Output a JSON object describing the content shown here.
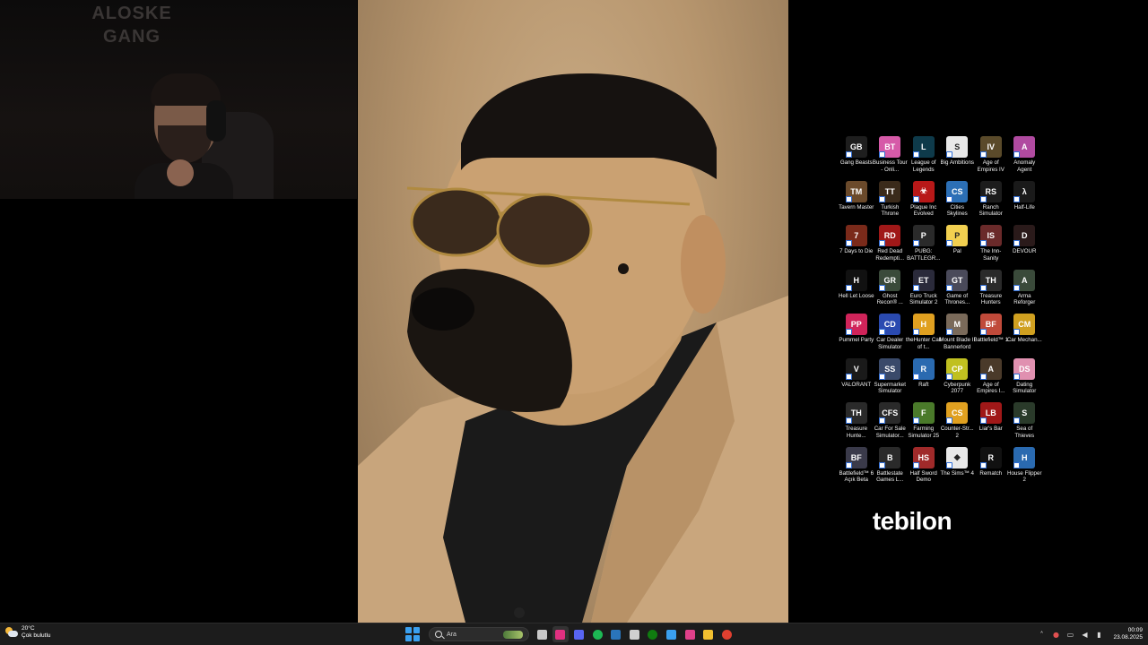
{
  "webcam": {
    "overlay_lines": [
      "ALOSKE",
      "GANG"
    ]
  },
  "desktop": {
    "icons": [
      {
        "label": "Gang Beasts",
        "color": "#1e1e1e",
        "glyph": "GB",
        "icon": "game-icon"
      },
      {
        "label": "Business Tour - Onli...",
        "color": "#d65aa8",
        "glyph": "BT",
        "icon": "game-icon"
      },
      {
        "label": "League of Legends",
        "color": "#0e3a4a",
        "glyph": "L",
        "icon": "game-icon"
      },
      {
        "label": "Big Ambitions",
        "color": "#e8e8e8",
        "glyph": "S",
        "icon": "game-icon"
      },
      {
        "label": "Age of Empires IV",
        "color": "#5a4a2a",
        "glyph": "IV",
        "icon": "game-icon"
      },
      {
        "label": "Anomaly Agent",
        "color": "#b04aa0",
        "glyph": "A",
        "icon": "game-icon"
      },
      {
        "label": "Tavern Master",
        "color": "#6b4a2b",
        "glyph": "TM",
        "icon": "game-icon"
      },
      {
        "label": "Turkish Throne",
        "color": "#3a2a1a",
        "glyph": "TT",
        "icon": "game-icon"
      },
      {
        "label": "Plague Inc Evolved",
        "color": "#b81818",
        "glyph": "☣",
        "icon": "game-icon"
      },
      {
        "label": "Cities Skylines",
        "color": "#2c6fb5",
        "glyph": "CS",
        "icon": "game-icon"
      },
      {
        "label": "Ranch Simulator",
        "color": "#1c1c1c",
        "glyph": "RS",
        "icon": "game-icon"
      },
      {
        "label": "Half-Life",
        "color": "#1a1a1a",
        "glyph": "λ",
        "icon": "game-icon"
      },
      {
        "label": "7 Days to Die",
        "color": "#7a2a1a",
        "glyph": "7",
        "icon": "game-icon"
      },
      {
        "label": "Red Dead Redempti...",
        "color": "#a01818",
        "glyph": "RD",
        "icon": "game-icon"
      },
      {
        "label": "PUBG: BATTLEGR...",
        "color": "#2a2a2a",
        "glyph": "P",
        "icon": "game-icon"
      },
      {
        "label": "Pal",
        "color": "#f2d050",
        "glyph": "P",
        "icon": "game-icon"
      },
      {
        "label": "The Inn-Sanity",
        "color": "#6a2a2a",
        "glyph": "IS",
        "icon": "game-icon"
      },
      {
        "label": "DEVOUR",
        "color": "#2a1a1a",
        "glyph": "D",
        "icon": "game-icon"
      },
      {
        "label": "Hell Let Loose",
        "color": "#111111",
        "glyph": "H",
        "icon": "game-icon"
      },
      {
        "label": "Ghost Recon® ...",
        "color": "#3a4a3a",
        "glyph": "GR",
        "icon": "game-icon"
      },
      {
        "label": "Euro Truck Simulator 2",
        "color": "#2a2a3a",
        "glyph": "ET",
        "icon": "game-icon"
      },
      {
        "label": "Game of Thrones...",
        "color": "#4a4a5a",
        "glyph": "GT",
        "icon": "game-icon"
      },
      {
        "label": "Treasure Hunters",
        "color": "#2a2a2a",
        "glyph": "TH",
        "icon": "game-icon"
      },
      {
        "label": "Arma Reforger",
        "color": "#3a4a3a",
        "glyph": "A",
        "icon": "game-icon"
      },
      {
        "label": "Pummel Party",
        "color": "#d0245a",
        "glyph": "PP",
        "icon": "game-icon"
      },
      {
        "label": "Car Dealer Simulator",
        "color": "#2a4ab0",
        "glyph": "CD",
        "icon": "game-icon"
      },
      {
        "label": "theHunter Call of t...",
        "color": "#e0a020",
        "glyph": "H",
        "icon": "game-icon"
      },
      {
        "label": "Mount Blade II Bannerlord",
        "color": "#7a6a5a",
        "glyph": "M",
        "icon": "game-icon"
      },
      {
        "label": "Battlefield™ 1",
        "color": "#c04a3a",
        "glyph": "BF",
        "icon": "game-icon"
      },
      {
        "label": "Car Mechan...",
        "color": "#d0a020",
        "glyph": "CM",
        "icon": "game-icon"
      },
      {
        "label": "VALORANT",
        "color": "#1a1a1a",
        "glyph": "V",
        "icon": "game-icon"
      },
      {
        "label": "Supermarket Simulator",
        "color": "#3a4a6a",
        "glyph": "SS",
        "icon": "game-icon"
      },
      {
        "label": "Raft",
        "color": "#2a6ab0",
        "glyph": "R",
        "icon": "game-icon"
      },
      {
        "label": "Cyberpunk 2077",
        "color": "#c0c020",
        "glyph": "CP",
        "icon": "game-icon"
      },
      {
        "label": "Age of Empires I...",
        "color": "#4a3a2a",
        "glyph": "A",
        "icon": "game-icon"
      },
      {
        "label": "Dating Simulator",
        "color": "#e090b0",
        "glyph": "DS",
        "icon": "game-icon"
      },
      {
        "label": "Treasure Hunte...",
        "color": "#2a2a2a",
        "glyph": "TH",
        "icon": "game-icon"
      },
      {
        "label": "Car For Sale Simulator...",
        "color": "#2a2a2a",
        "glyph": "CFS",
        "icon": "game-icon"
      },
      {
        "label": "Farming Simulator 25",
        "color": "#4a7a2a",
        "glyph": "F",
        "icon": "game-icon"
      },
      {
        "label": "Counter-Str... 2",
        "color": "#e0a020",
        "glyph": "CS",
        "icon": "game-icon"
      },
      {
        "label": "Liar's Bar",
        "color": "#a01818",
        "glyph": "LB",
        "icon": "game-icon"
      },
      {
        "label": "Sea of Thieves",
        "color": "#2a3a2a",
        "glyph": "S",
        "icon": "game-icon"
      },
      {
        "label": "Battlefield™ 6 Açık Beta",
        "color": "#3a3a4a",
        "glyph": "BF",
        "icon": "game-icon"
      },
      {
        "label": "Battlestate Games L...",
        "color": "#2a2a2a",
        "glyph": "B",
        "icon": "game-icon"
      },
      {
        "label": "Half Sword Demo",
        "color": "#a02a2a",
        "glyph": "HS",
        "icon": "game-icon"
      },
      {
        "label": "The Sims™ 4",
        "color": "#e8e8e8",
        "glyph": "◆",
        "icon": "game-icon"
      },
      {
        "label": "Rematch",
        "color": "#111111",
        "glyph": "R",
        "icon": "game-icon"
      },
      {
        "label": "House Flipper 2",
        "color": "#2a6ab0",
        "glyph": "H",
        "icon": "game-icon"
      }
    ],
    "brand": "tebilon"
  },
  "taskbar": {
    "weather_temp": "20°C",
    "weather_desc": "Çok bulutlu",
    "search_placeholder": "Ara",
    "apps": [
      {
        "name": "task-view-icon",
        "color": "#c8c8c8",
        "active": false
      },
      {
        "name": "app-icon",
        "color": "#e03080",
        "active": true
      },
      {
        "name": "discord-icon",
        "color": "#5865f2",
        "active": false
      },
      {
        "name": "spotify-icon",
        "color": "#1db954",
        "active": false
      },
      {
        "name": "steam-icon",
        "color": "#2a75bb",
        "active": false
      },
      {
        "name": "epic-games-icon",
        "color": "#d0d0d0",
        "active": false
      },
      {
        "name": "xbox-icon",
        "color": "#107c10",
        "active": false
      },
      {
        "name": "store-icon",
        "color": "#3aa0f0",
        "active": false
      },
      {
        "name": "instagram-icon",
        "color": "#e0408a",
        "active": false
      },
      {
        "name": "file-explorer-icon",
        "color": "#f2c030",
        "active": false
      },
      {
        "name": "chrome-icon",
        "color": "#e04030",
        "active": false
      }
    ],
    "time": "00:09",
    "date": "23.08.2025"
  }
}
